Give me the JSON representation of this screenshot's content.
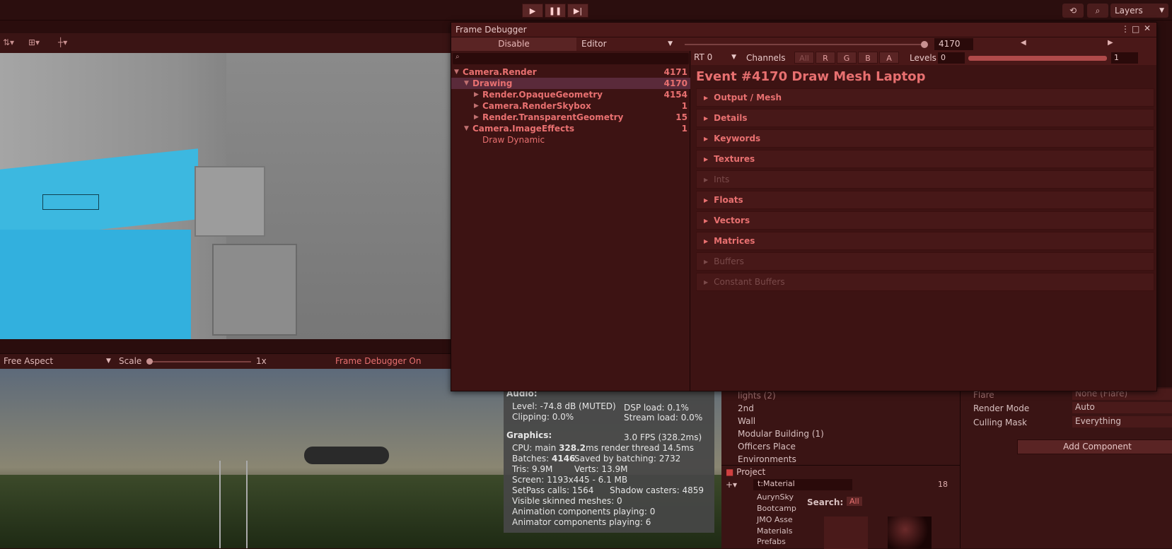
{
  "toolbar": {
    "play_icon": "play-icon",
    "pause_icon": "pause-icon",
    "step_icon": "step-icon",
    "layers_label": "Layers"
  },
  "game_bar": {
    "aspect": "Free Aspect",
    "scale_label": "Scale",
    "scale_value": "1x",
    "frame_debugger_status": "Frame Debugger On"
  },
  "frame_debugger": {
    "title": "Frame Debugger",
    "disable_label": "Disable",
    "target": "Editor",
    "event_index": "4170",
    "rt": "RT 0",
    "channels_label": "Channels",
    "channels": [
      "All",
      "R",
      "G",
      "B",
      "A"
    ],
    "levels_label": "Levels",
    "levels_min": "0",
    "levels_max": "1",
    "tree": [
      {
        "label": "Camera.Render",
        "count": "4171",
        "depth": 0,
        "expanded": true
      },
      {
        "label": "Drawing",
        "count": "4170",
        "depth": 1,
        "expanded": true,
        "selected": true
      },
      {
        "label": "Render.OpaqueGeometry",
        "count": "4154",
        "depth": 2,
        "expanded": false
      },
      {
        "label": "Camera.RenderSkybox",
        "count": "1",
        "depth": 2,
        "expanded": false
      },
      {
        "label": "Render.TransparentGeometry",
        "count": "15",
        "depth": 2,
        "expanded": false
      },
      {
        "label": "Camera.ImageEffects",
        "count": "1",
        "depth": 1,
        "expanded": true
      },
      {
        "label": "Draw Dynamic",
        "count": "",
        "depth": 2,
        "leaf": true
      }
    ],
    "event_title": "Event #4170 Draw Mesh Laptop",
    "sections": [
      {
        "label": "Output / Mesh",
        "enabled": true
      },
      {
        "label": "Details",
        "enabled": true
      },
      {
        "label": "Keywords",
        "enabled": true
      },
      {
        "label": "Textures",
        "enabled": true
      },
      {
        "label": "Ints",
        "enabled": false
      },
      {
        "label": "Floats",
        "enabled": true
      },
      {
        "label": "Vectors",
        "enabled": true
      },
      {
        "label": "Matrices",
        "enabled": true
      },
      {
        "label": "Buffers",
        "enabled": false
      },
      {
        "label": "Constant Buffers",
        "enabled": false
      }
    ]
  },
  "stats": {
    "audio_header": "Audio:",
    "level": "Level: -74.8 dB (MUTED)",
    "dsp_load": "DSP load: 0.1%",
    "clipping": "Clipping: 0.0%",
    "stream_load": "Stream load: 0.0%",
    "graphics_header": "Graphics:",
    "fps": "3.0 FPS (328.2ms)",
    "cpu_prefix": "CPU: main ",
    "cpu_main": "328.2",
    "cpu_suffix": "ms  render thread 14.5ms",
    "batches_prefix": "Batches: ",
    "batches": "4146",
    "saved_batching": "Saved by batching: 2732",
    "tris": "Tris: 9.9M",
    "verts": "Verts: 13.9M",
    "screen": "Screen: 1193x445 - 6.1 MB",
    "setpass": "SetPass calls: 1564",
    "shadow_casters": "Shadow casters: 4859",
    "skinned": "Visible skinned meshes: 0",
    "anim_components": "Animation components playing: 0",
    "animator_components": "Animator components playing: 6"
  },
  "hierarchy": {
    "items": [
      "lights (2)",
      "2nd",
      "Wall",
      "Modular Building (1)",
      "Officers Place",
      "Environments"
    ]
  },
  "inspector": {
    "flare_label": "Flare",
    "flare_value": "None (Flare)",
    "render_mode_label": "Render Mode",
    "render_mode_value": "Auto",
    "culling_mask_label": "Culling Mask",
    "culling_mask_value": "Everything",
    "add_component": "Add Component"
  },
  "project": {
    "tab_label": "Project",
    "search_value": "t:Material",
    "hidden_count": "18",
    "search_label": "Search:",
    "search_scope": "All",
    "folders": [
      "AurynSky",
      "Bootcamp",
      "JMO Asse",
      "Materials",
      "Prefabs"
    ]
  },
  "colors": {
    "accent_red": "#e87070",
    "selection": "#5a2a3a",
    "panel": "#3d1313"
  }
}
